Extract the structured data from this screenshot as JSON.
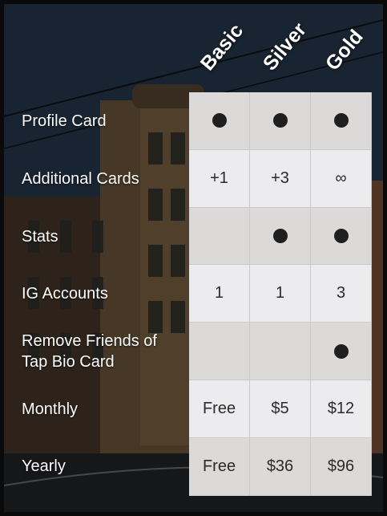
{
  "columns": [
    "Basic",
    "Silver",
    "Gold"
  ],
  "rows": [
    {
      "label": "Profile Card",
      "values": [
        "dot",
        "dot",
        "dot"
      ]
    },
    {
      "label": "Additional Cards",
      "values": [
        "+1",
        "+3",
        "∞"
      ]
    },
    {
      "label": "Stats",
      "values": [
        "",
        "dot",
        "dot"
      ]
    },
    {
      "label": "IG Accounts",
      "values": [
        "1",
        "1",
        "3"
      ]
    },
    {
      "label": "Remove Friends of Tap Bio Card",
      "values": [
        "",
        "",
        "dot"
      ]
    },
    {
      "label": "Monthly",
      "values": [
        "Free",
        "$5",
        "$12"
      ]
    },
    {
      "label": "Yearly",
      "values": [
        "Free",
        "$36",
        "$96"
      ]
    }
  ],
  "colors": {
    "cell_dark": "#dcdad9",
    "cell_light": "#ececee",
    "dot": "#1f1f1f",
    "label_text": "#ffffff"
  },
  "icons": {
    "included": "filled-circle-icon"
  }
}
